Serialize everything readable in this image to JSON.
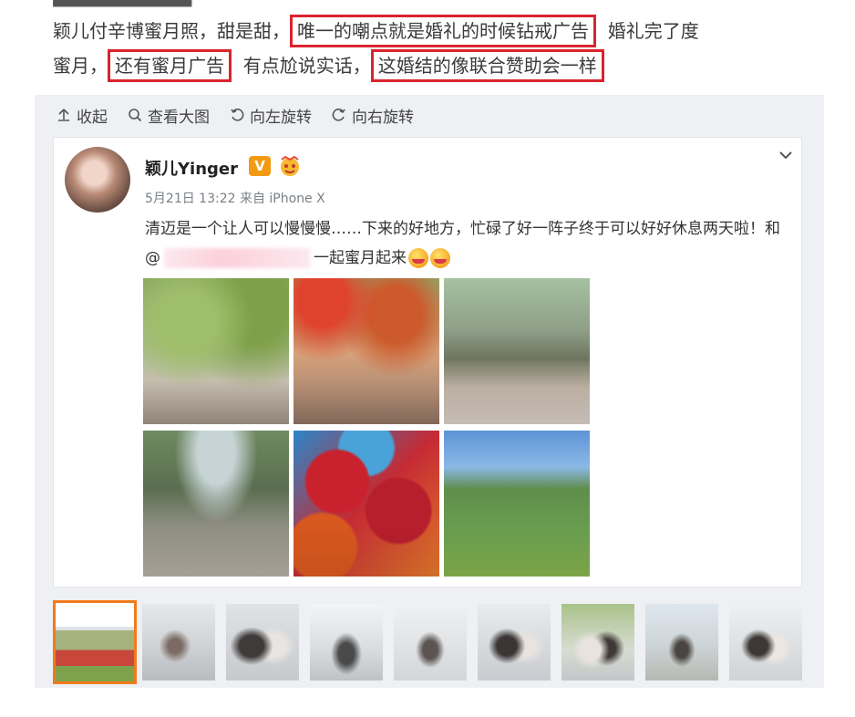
{
  "article": {
    "line1_a": "颖儿付辛博蜜月照，甜是甜，",
    "line1_hl": "唯一的嘲点就是婚礼的时候钻戒广告",
    "line1_b": "婚礼完了度",
    "line2_a": "蜜月，",
    "line2_hl1": "还有蜜月广告",
    "line2_b": "有点尬说实话，",
    "line2_hl2": "这婚结的像联合赞助会一样"
  },
  "colors": {
    "highlight_border": "#d9242e",
    "active_thumb": "#f07b1b",
    "v_badge": "#f29a12"
  },
  "toolbar": {
    "collapse": "收起",
    "view_large": "查看大图",
    "rotate_left": "向左旋转",
    "rotate_right": "向右旋转"
  },
  "post": {
    "username": "颖儿Yinger",
    "badge": "V",
    "meta": "5月21日 13:22 来自 iPhone X",
    "text_a": "清迈是一个让人可以慢慢慢……下来的好地方，忙碌了好一阵子终于可以好好休息两天啦！和@",
    "text_b": "一起蜜月起来"
  },
  "icons": {
    "collapse": "arrow-up-icon",
    "view_large": "magnifier-icon",
    "rotate_left": "rotate-left-icon",
    "rotate_right": "rotate-right-icon",
    "menu": "chevron-down-icon"
  }
}
